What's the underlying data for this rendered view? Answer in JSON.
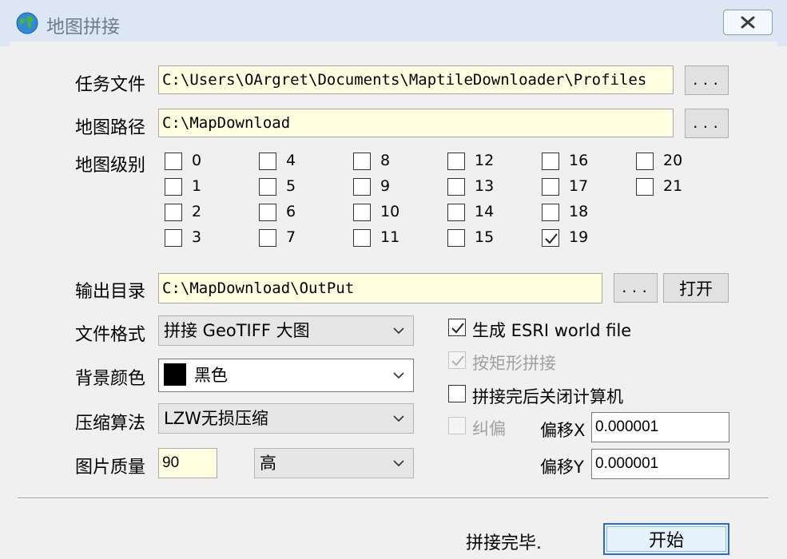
{
  "window": {
    "title": "地图拼接"
  },
  "task_file": {
    "label": "任务文件",
    "value": "C:\\Users\\OArgret\\Documents\\MaptileDownloader\\Profiles",
    "browse": "..."
  },
  "map_path": {
    "label": "地图路径",
    "value": "C:\\MapDownload",
    "browse": "..."
  },
  "map_levels": {
    "label": "地图级别",
    "levels": [
      {
        "n": "0",
        "checked": false
      },
      {
        "n": "1",
        "checked": false
      },
      {
        "n": "2",
        "checked": false
      },
      {
        "n": "3",
        "checked": false
      },
      {
        "n": "4",
        "checked": false
      },
      {
        "n": "5",
        "checked": false
      },
      {
        "n": "6",
        "checked": false
      },
      {
        "n": "7",
        "checked": false
      },
      {
        "n": "8",
        "checked": false
      },
      {
        "n": "9",
        "checked": false
      },
      {
        "n": "10",
        "checked": false
      },
      {
        "n": "11",
        "checked": false
      },
      {
        "n": "12",
        "checked": false
      },
      {
        "n": "13",
        "checked": false
      },
      {
        "n": "14",
        "checked": false
      },
      {
        "n": "15",
        "checked": false
      },
      {
        "n": "16",
        "checked": false
      },
      {
        "n": "17",
        "checked": false
      },
      {
        "n": "18",
        "checked": false
      },
      {
        "n": "19",
        "checked": true
      },
      {
        "n": "20",
        "checked": false
      },
      {
        "n": "21",
        "checked": false
      }
    ]
  },
  "output_dir": {
    "label": "输出目录",
    "value": "C:\\MapDownload\\OutPut",
    "browse": "...",
    "open": "打开"
  },
  "file_format": {
    "label": "文件格式",
    "value": "拼接 GeoTIFF 大图"
  },
  "background_color": {
    "label": "背景颜色",
    "value": "黑色",
    "swatch": "#000000"
  },
  "compression": {
    "label": "压缩算法",
    "value": "LZW无损压缩"
  },
  "image_quality": {
    "label": "图片质量",
    "value": "90",
    "level": "高"
  },
  "options": {
    "esri_world_file": {
      "label": "生成 ESRI world file",
      "checked": true,
      "enabled": true
    },
    "rect_stitch": {
      "label": "按矩形拼接",
      "checked": true,
      "enabled": false
    },
    "shutdown_after": {
      "label": "拼接完后关闭计算机",
      "checked": false,
      "enabled": true
    },
    "correction": {
      "label": "纠偏",
      "checked": false,
      "enabled": false
    }
  },
  "offset_x": {
    "label": "偏移X",
    "value": "0.000001"
  },
  "offset_y": {
    "label": "偏移Y",
    "value": "0.000001"
  },
  "status": "拼接完毕.",
  "start_button": "开始"
}
